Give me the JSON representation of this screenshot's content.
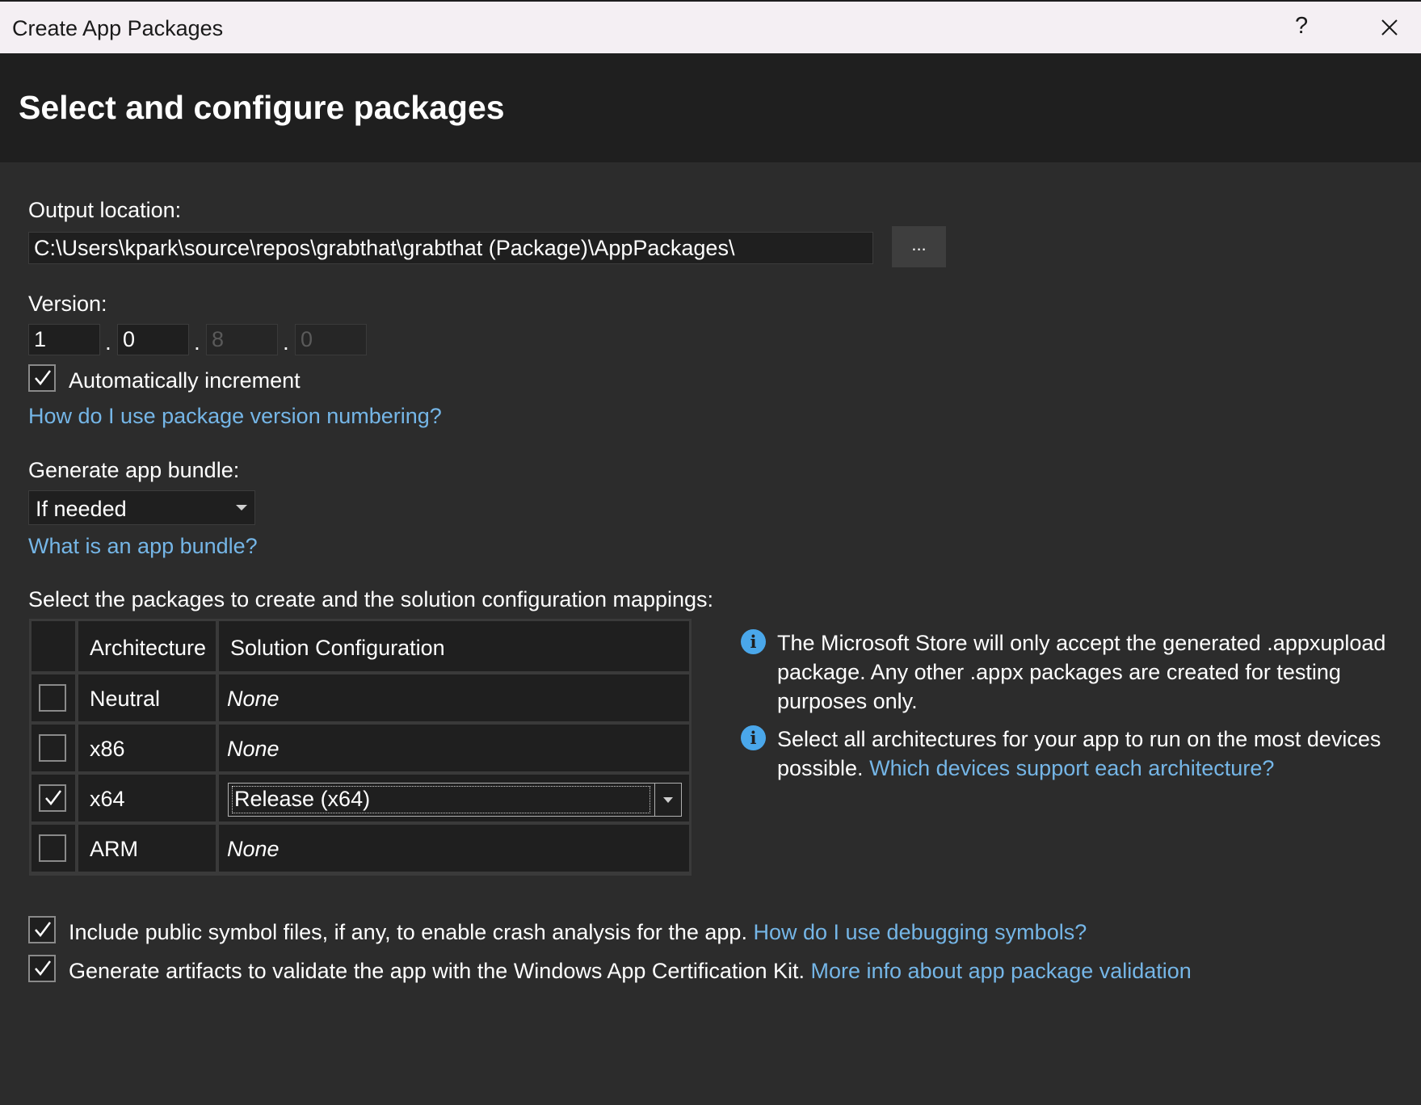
{
  "window": {
    "title": "Create App Packages",
    "help_label": "?",
    "close_icon": "close-icon"
  },
  "page": {
    "heading": "Select and configure packages"
  },
  "output": {
    "label": "Output location:",
    "path": "C:\\Users\\kpark\\source\\repos\\grabthat\\grabthat (Package)\\AppPackages\\",
    "browse_label": "..."
  },
  "version": {
    "label": "Version:",
    "major": "1",
    "minor": "0",
    "build": "8",
    "revision": "0",
    "separator": ".",
    "auto_increment_label": "Automatically increment",
    "auto_increment_checked": true,
    "help_link": "How do I use package version numbering?"
  },
  "bundle": {
    "label": "Generate app bundle:",
    "selected": "If needed",
    "help_link": "What is an app bundle?"
  },
  "packages": {
    "label": "Select the packages to create and the solution configuration mappings:",
    "columns": [
      "Architecture",
      "Solution Configuration"
    ],
    "rows": [
      {
        "checked": false,
        "architecture": "Neutral",
        "configuration": "None"
      },
      {
        "checked": false,
        "architecture": "x86",
        "configuration": "None"
      },
      {
        "checked": true,
        "architecture": "x64",
        "configuration": "Release (x64)"
      },
      {
        "checked": false,
        "architecture": "ARM",
        "configuration": "None"
      }
    ]
  },
  "info": {
    "icon": "info-icon",
    "store_note": "The Microsoft Store will only accept the generated .appxupload package. Any other .appx packages are created for testing purposes only.",
    "arch_note": "Select all architectures for your app to run on the most devices possible.",
    "arch_link": "Which devices support each architecture?"
  },
  "options": {
    "symbols_label": "Include public symbol files, if any, to enable crash analysis for the app.",
    "symbols_link": "How do I use debugging symbols?",
    "symbols_checked": true,
    "wack_label": "Generate artifacts to validate the app with the Windows App Certification Kit.",
    "wack_link": "More info about app package validation",
    "wack_checked": true
  },
  "colors": {
    "background": "#2c2c2c",
    "header": "#1f1f1f",
    "link": "#75b6e7",
    "info": "#4aa7ea"
  }
}
